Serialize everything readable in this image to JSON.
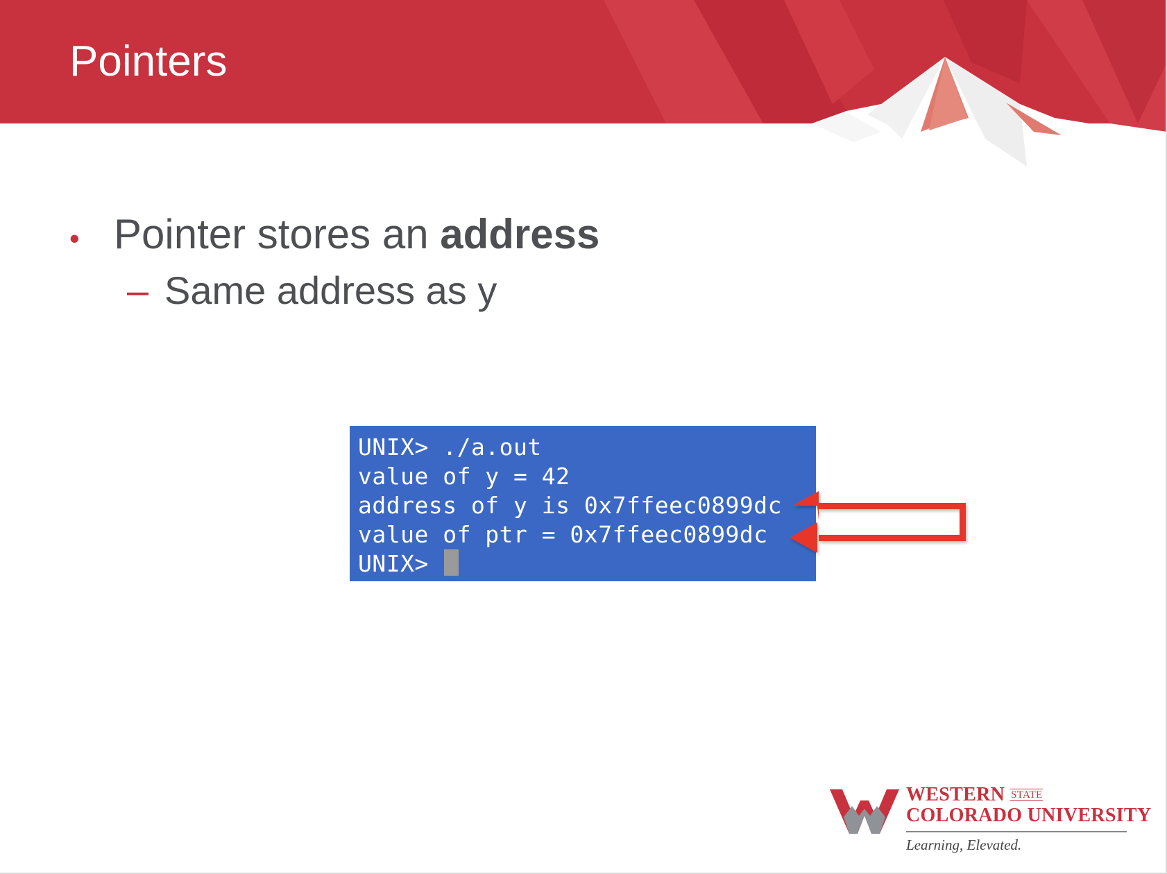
{
  "slide": {
    "title": "Pointers",
    "bullet": {
      "marker": "•",
      "text_before": "Pointer stores an ",
      "text_bold": "address"
    },
    "sub_bullet": {
      "marker": "–",
      "text": "Same address as y"
    }
  },
  "terminal": {
    "lines": [
      "UNIX> ./a.out",
      "value of y = 42",
      "address of y is 0x7ffeec0899dc",
      "value of ptr = 0x7ffeec0899dc",
      "UNIX> "
    ],
    "background": "#3b68c4"
  },
  "annotation": {
    "icon": "connector-arrows-icon",
    "color": "#e8342a"
  },
  "logo": {
    "line1": "Western",
    "line1_small": "STATE",
    "line2": "Colorado University",
    "tagline": "Learning, Elevated.",
    "icon": "mountain-w-logo-icon"
  },
  "colors": {
    "brand_red": "#c8313e",
    "text_gray": "#4d4f53"
  }
}
